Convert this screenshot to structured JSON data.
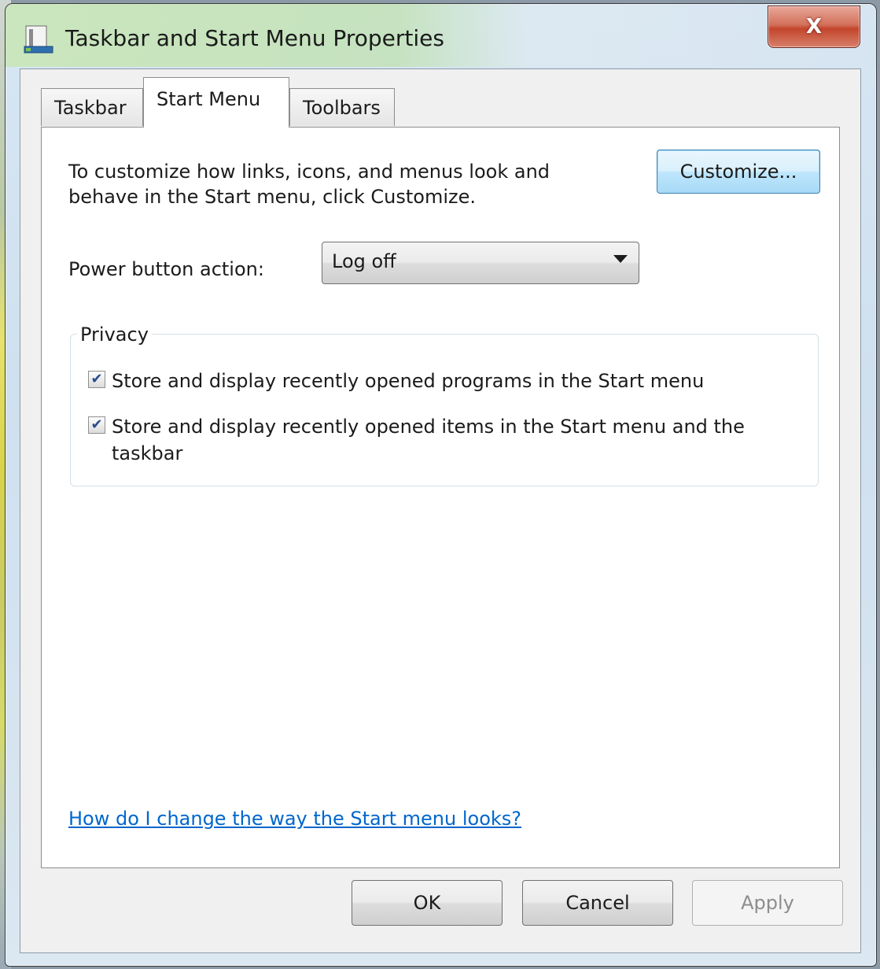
{
  "window": {
    "title": "Taskbar and Start Menu Properties",
    "close_label": "X"
  },
  "tabs": [
    {
      "label": "Taskbar",
      "active": false
    },
    {
      "label": "Start Menu",
      "active": true
    },
    {
      "label": "Toolbars",
      "active": false
    }
  ],
  "start_menu": {
    "description": "To customize how links, icons, and menus look and behave in the Start menu, click Customize.",
    "customize_label": "Customize...",
    "power_label": "Power button action:",
    "power_value": "Log off"
  },
  "privacy": {
    "legend": "Privacy",
    "options": [
      {
        "label": "Store and display recently opened programs in the Start menu",
        "checked": true
      },
      {
        "label": "Store and display recently opened items in the Start menu and the taskbar",
        "checked": true
      }
    ]
  },
  "help_link": "How do I change the way the Start menu looks?",
  "footer": {
    "ok_label": "OK",
    "cancel_label": "Cancel",
    "apply_label": "Apply"
  },
  "colors": {
    "link": "#0066cc",
    "close_button": "#c3452c",
    "check_mark": "#2a4d8f"
  }
}
